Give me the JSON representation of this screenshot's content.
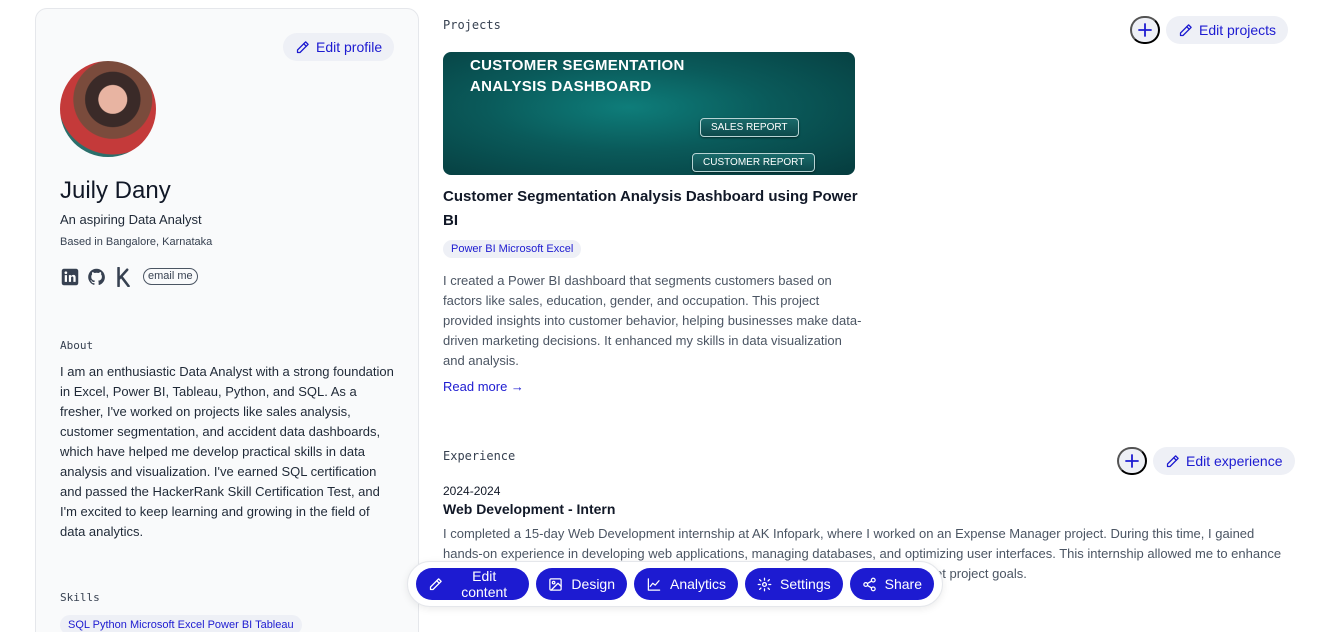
{
  "profile": {
    "edit_label": "Edit profile",
    "name": "Juily Dany",
    "tagline": "An aspiring Data Analyst",
    "location": "Based in Bangalore, Karnataka",
    "email_label": "email me",
    "socials": [
      "linkedin-icon",
      "github-icon",
      "kaggle-icon"
    ]
  },
  "about": {
    "label": "About",
    "text": "I am an enthusiastic Data Analyst with a strong foundation in Excel, Power BI, Tableau, Python, and SQL. As a fresher, I've worked on projects like sales analysis, customer segmentation, and accident data dashboards, which have helped me develop practical skills in data analysis and visualization. I've earned SQL certification and passed the HackerRank Skill Certification Test, and I'm excited to keep learning and growing in the field of data analytics."
  },
  "skills": {
    "label": "Skills",
    "tags": "SQL Python Microsoft Excel Power BI Tableau"
  },
  "projects": {
    "label": "Projects",
    "add_label": "+",
    "edit_label": "Edit projects",
    "items": [
      {
        "banner_title_line1": "CUSTOMER SEGMENTATION",
        "banner_title_line2": "ANALYSIS DASHBOARD",
        "banner_btn1": "SALES REPORT",
        "banner_btn2": "CUSTOMER REPORT",
        "title": "Customer Segmentation Analysis Dashboard using Power BI",
        "tags": "Power BI Microsoft Excel",
        "description": "I created a Power BI dashboard that segments customers based on factors like sales, education, gender, and occupation. This project provided insights into customer behavior, helping businesses make data-driven marketing decisions. It enhanced my skills in data visualization and analysis.",
        "read_more": "Read more →"
      }
    ]
  },
  "experience": {
    "label": "Experience",
    "add_label": "+",
    "edit_label": "Edit experience",
    "items": [
      {
        "years": "2024-2024",
        "role": "Web Development - Intern",
        "description": "I completed a 15-day Web Development internship at AK Infopark, where I worked on an Expense Manager project. During this time, I gained hands-on experience in developing web applications, managing databases, and optimizing user interfaces. This internship allowed me to enhance my technical skills and problem-solving abilities, while collaborating with a team to meet project goals."
      }
    ]
  },
  "toolbar": {
    "edit_content": "Edit content",
    "design": "Design",
    "analytics": "Analytics",
    "settings": "Settings",
    "share": "Share"
  },
  "colors": {
    "accent": "#1d1bd1",
    "chip_bg": "#eef0f6",
    "sidebar_bg": "#f9fafb",
    "banner_teal": "#0a5a5a"
  }
}
